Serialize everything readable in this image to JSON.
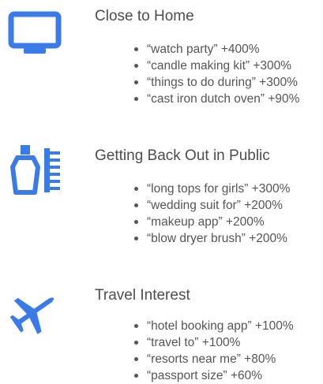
{
  "colors": {
    "accent": "#3b7be8",
    "text": "#555555"
  },
  "sections": [
    {
      "icon": "monitor-icon",
      "title": "Close to Home",
      "items": [
        "“watch party” +400%",
        "“candle making kit” +300%",
        "“things to do during” +300%",
        "“cast iron dutch oven” +90%"
      ]
    },
    {
      "icon": "beauty-products-icon",
      "title": "Getting Back Out in Public",
      "items": [
        "“long tops for girls” +300%",
        "“wedding suit for” +200%",
        "“makeup app” +200%",
        "“blow dryer brush” +200%"
      ]
    },
    {
      "icon": "airplane-icon",
      "title": "Travel Interest",
      "items": [
        "“hotel booking app” +100%",
        "“travel to” +100%",
        "“resorts near me” +80%",
        "“passport size” +60%"
      ]
    }
  ]
}
